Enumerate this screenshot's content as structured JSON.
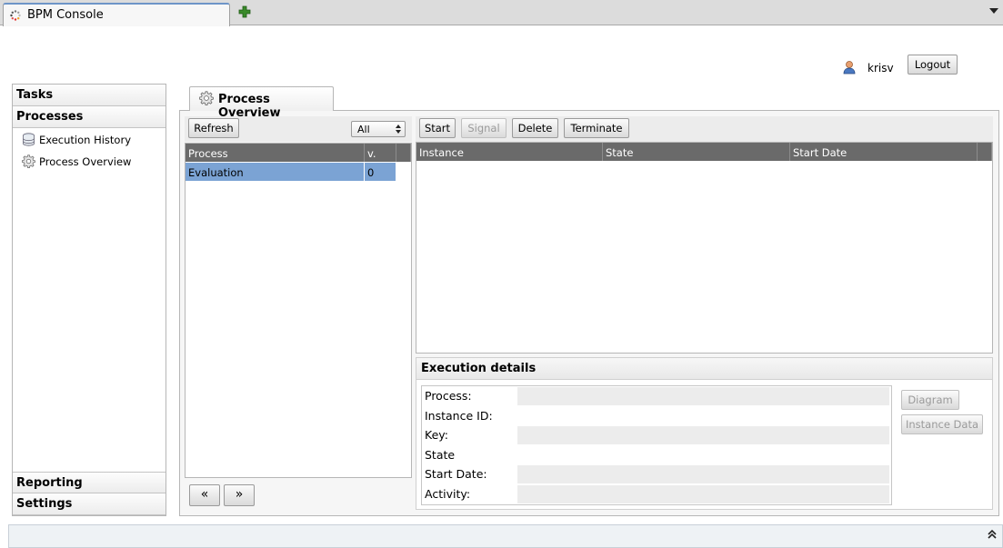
{
  "browser": {
    "tab_title": "BPM Console"
  },
  "header": {
    "username": "krisv",
    "logout_label": "Logout"
  },
  "nav": {
    "sections": [
      "Tasks",
      "Processes",
      "Reporting",
      "Settings"
    ],
    "items": [
      {
        "label": "Execution History",
        "icon": "database-icon"
      },
      {
        "label": "Process Overview",
        "icon": "gear-icon"
      }
    ]
  },
  "panel": {
    "tab_label": "Process Overview"
  },
  "process_list": {
    "refresh_label": "Refresh",
    "filter_value": "All",
    "columns": [
      "Process",
      "v."
    ],
    "rows": [
      {
        "process": "Evaluation",
        "version": "0"
      }
    ],
    "prev_label": "«",
    "next_label": "»"
  },
  "instances": {
    "buttons": {
      "start": "Start",
      "signal": "Signal",
      "delete": "Delete",
      "terminate": "Terminate"
    },
    "columns": [
      "Instance",
      "State",
      "Start Date"
    ]
  },
  "execution_details": {
    "title": "Execution details",
    "fields": [
      "Process:",
      "Instance ID:",
      "Key:",
      "State",
      "Start Date:",
      "Activity:"
    ],
    "diagram_label": "Diagram",
    "instance_data_label": "Instance Data"
  },
  "colors": {
    "selected_row": "#7ba3d4",
    "table_header": "#6a6a6a"
  }
}
